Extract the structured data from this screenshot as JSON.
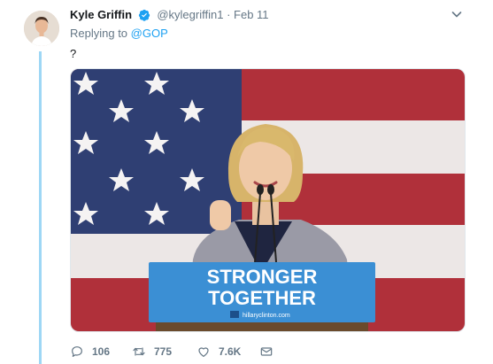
{
  "tweet": {
    "author_name": "Kyle Griffin",
    "handle": "@kylegriffin1",
    "separator": "·",
    "date": "Feb 11",
    "reply_prefix": "Replying to",
    "reply_mention": "@GOP",
    "text": "?",
    "media": {
      "podium_line1": "STRONGER",
      "podium_line2": "TOGETHER",
      "podium_url": "hillaryclinton.com"
    },
    "actions": {
      "reply_count": "106",
      "retweet_count": "775",
      "like_count": "7.6K"
    },
    "icons": {
      "verified": "verified-badge-icon",
      "more": "chevron-down-icon",
      "reply": "reply-icon",
      "retweet": "retweet-icon",
      "like": "heart-icon",
      "dm": "envelope-icon"
    }
  },
  "colors": {
    "accent": "#1da1f2",
    "thread_line": "#9ed7f5",
    "muted": "#657786",
    "flag_blue": "#2f3f73",
    "flag_red": "#b0303a",
    "podium_blue": "#3b8fd4"
  }
}
